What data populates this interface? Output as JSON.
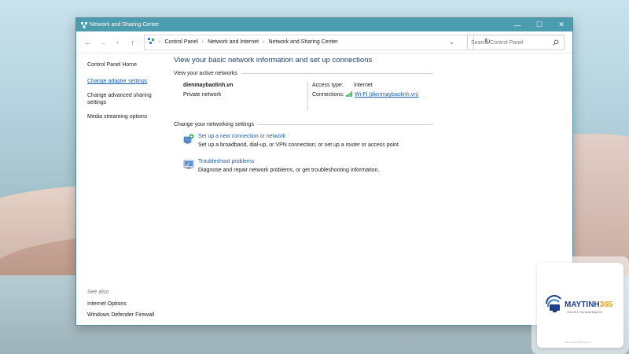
{
  "window": {
    "title": "Network and Sharing Center",
    "controls": {
      "minimize": "—",
      "maximize": "☐",
      "close": "✕"
    }
  },
  "address": {
    "crumbs": [
      "Control Panel",
      "Network and Internet",
      "Network and Sharing Center"
    ],
    "search_placeholder": "Search Control Panel"
  },
  "sidebar": {
    "home": "Control Panel Home",
    "items": [
      "Change adapter settings",
      "Change advanced sharing settings",
      "Media streaming options"
    ],
    "see_also_label": "See also",
    "see_also": [
      "Internet Options",
      "Windows Defender Firewall"
    ]
  },
  "main": {
    "heading": "View your basic network information and set up connections",
    "active_networks_label": "View your active networks",
    "network_name": "dienmaybaolinh.vn",
    "network_type": "Private network",
    "access_type_label": "Access type:",
    "access_type_value": "Internet",
    "connections_label": "Connections:",
    "connection_value": "Wi-Fi (dienmaybaolinh.vn)",
    "change_settings_label": "Change your networking settings",
    "tasks": [
      {
        "title": "Set up a new connection or network",
        "desc": "Set up a broadband, dial-up, or VPN connection; or set up a router or access point."
      },
      {
        "title": "Troubleshoot problems",
        "desc": "Diagnose and repair network problems, or get troubleshooting information."
      }
    ]
  },
  "watermark": {
    "brand_main": "MAYTINH",
    "brand_num": "365",
    "tagline": "Chia sẻ & Thủ thuật Máy tính",
    "footer": "www.maytinh365.com.vn"
  },
  "colors": {
    "titlebar": "#4a9cae",
    "link": "#1a5fb4",
    "heading": "#1e3f73"
  }
}
